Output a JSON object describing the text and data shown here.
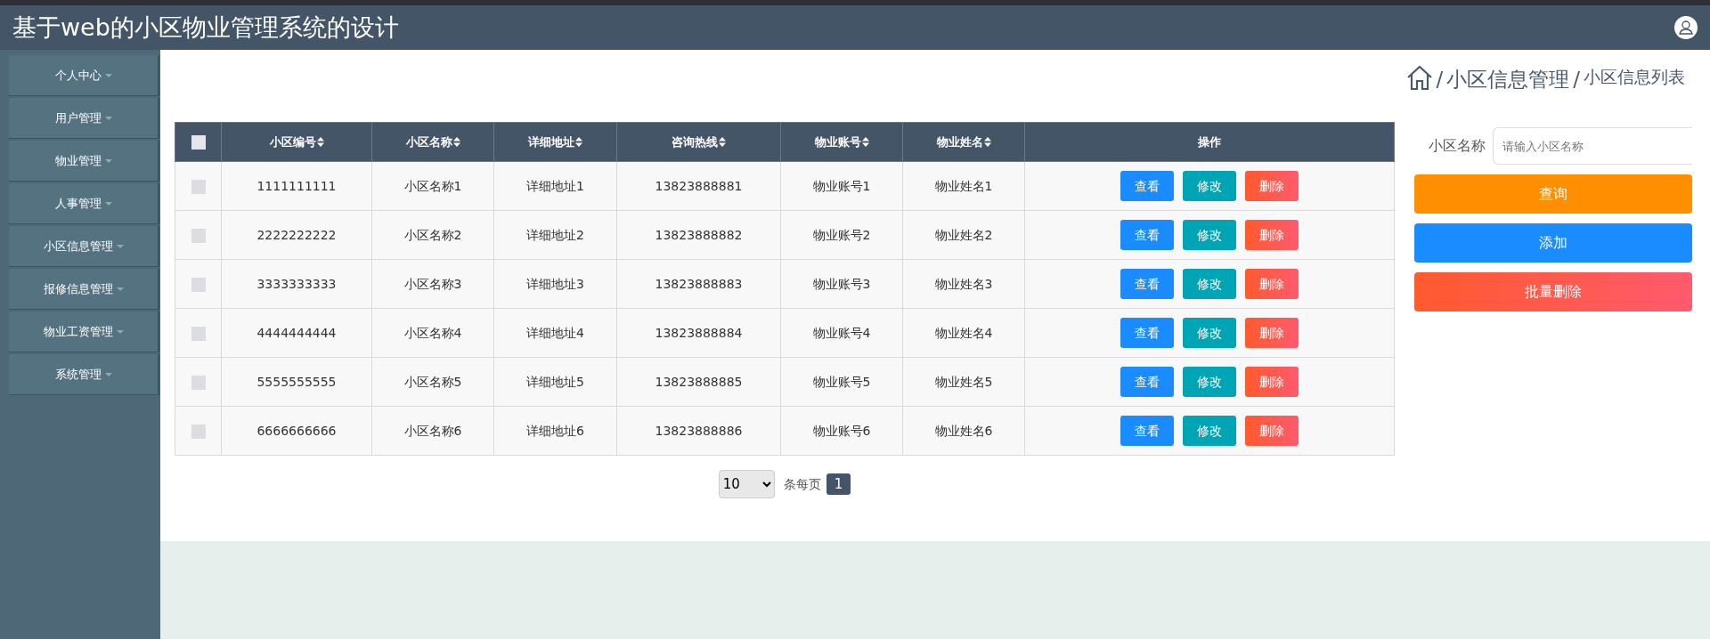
{
  "header": {
    "title": "基于web的小区物业管理系统的设计"
  },
  "sidebar": {
    "items": [
      {
        "label": "个人中心"
      },
      {
        "label": "用户管理"
      },
      {
        "label": "物业管理"
      },
      {
        "label": "人事管理"
      },
      {
        "label": "小区信息管理"
      },
      {
        "label": "报修信息管理"
      },
      {
        "label": "物业工资管理"
      },
      {
        "label": "系统管理"
      }
    ]
  },
  "breadcrumb": {
    "separator": "/",
    "items": [
      "小区信息管理",
      "小区信息列表"
    ]
  },
  "table": {
    "select_all": {
      "checked": false
    },
    "columns": [
      {
        "label": "小区编号",
        "sortable": true
      },
      {
        "label": "小区名称",
        "sortable": true
      },
      {
        "label": "详细地址",
        "sortable": true
      },
      {
        "label": "咨询热线",
        "sortable": true
      },
      {
        "label": "物业账号",
        "sortable": true
      },
      {
        "label": "物业姓名",
        "sortable": true
      },
      {
        "label": "操作",
        "sortable": false
      }
    ],
    "rows": [
      {
        "checked": false,
        "cells": [
          "1111111111",
          "小区名称1",
          "详细地址1",
          "13823888881",
          "物业账号1",
          "物业姓名1"
        ],
        "actions": [
          {
            "label": "查看",
            "kind": "view"
          },
          {
            "label": "修改",
            "kind": "edit"
          },
          {
            "label": "删除",
            "kind": "delete"
          }
        ]
      },
      {
        "checked": false,
        "cells": [
          "2222222222",
          "小区名称2",
          "详细地址2",
          "13823888882",
          "物业账号2",
          "物业姓名2"
        ],
        "actions": [
          {
            "label": "查看",
            "kind": "view"
          },
          {
            "label": "修改",
            "kind": "edit"
          },
          {
            "label": "删除",
            "kind": "delete"
          }
        ]
      },
      {
        "checked": false,
        "cells": [
          "3333333333",
          "小区名称3",
          "详细地址3",
          "13823888883",
          "物业账号3",
          "物业姓名3"
        ],
        "actions": [
          {
            "label": "查看",
            "kind": "view"
          },
          {
            "label": "修改",
            "kind": "edit"
          },
          {
            "label": "删除",
            "kind": "delete"
          }
        ]
      },
      {
        "checked": false,
        "cells": [
          "4444444444",
          "小区名称4",
          "详细地址4",
          "13823888884",
          "物业账号4",
          "物业姓名4"
        ],
        "actions": [
          {
            "label": "查看",
            "kind": "view"
          },
          {
            "label": "修改",
            "kind": "edit"
          },
          {
            "label": "删除",
            "kind": "delete"
          }
        ]
      },
      {
        "checked": false,
        "cells": [
          "5555555555",
          "小区名称5",
          "详细地址5",
          "13823888885",
          "物业账号5",
          "物业姓名5"
        ],
        "actions": [
          {
            "label": "查看",
            "kind": "view"
          },
          {
            "label": "修改",
            "kind": "edit"
          },
          {
            "label": "删除",
            "kind": "delete"
          }
        ]
      },
      {
        "checked": false,
        "cells": [
          "6666666666",
          "小区名称6",
          "详细地址6",
          "13823888886",
          "物业账号6",
          "物业姓名6"
        ],
        "actions": [
          {
            "label": "查看",
            "kind": "view"
          },
          {
            "label": "修改",
            "kind": "edit"
          },
          {
            "label": "删除",
            "kind": "delete"
          }
        ]
      }
    ]
  },
  "pagination": {
    "page_size": "10",
    "per_page_label": "条每页",
    "pages": [
      {
        "label": "1",
        "selected": true
      }
    ]
  },
  "search": {
    "label": "小区名称",
    "placeholder": "请输入小区名称"
  },
  "buttons": [
    {
      "label": "查询",
      "kind": "query"
    },
    {
      "label": "添加",
      "kind": "add"
    },
    {
      "label": "批量删除",
      "kind": "batch_delete"
    }
  ]
}
